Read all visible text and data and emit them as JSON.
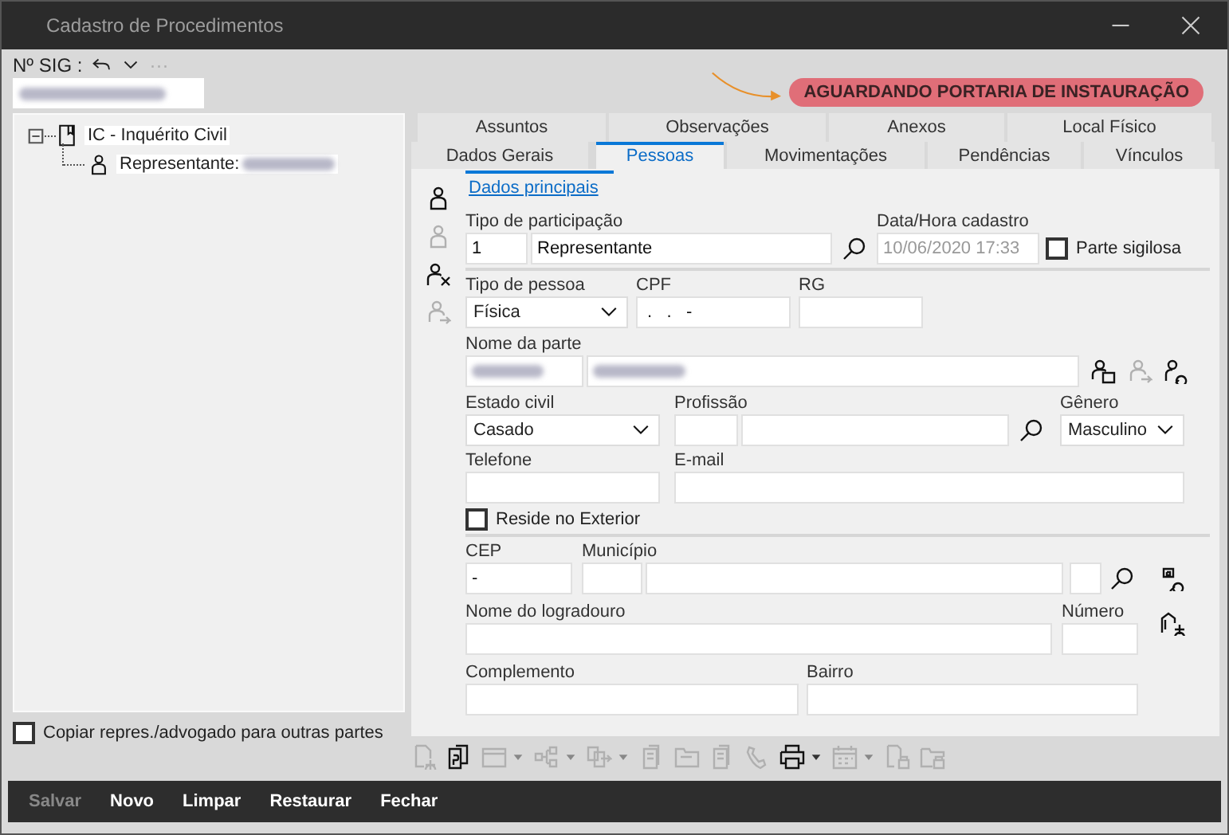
{
  "window": {
    "title": "Cadastro de Procedimentos"
  },
  "sig": {
    "label": "Nº SIG :",
    "more": "···",
    "blurred": true
  },
  "status_badge": {
    "label": "AGUARDANDO PORTARIA DE INSTAURAÇÃO"
  },
  "tree": [
    {
      "label": "IC - Inquérito Civil",
      "expanded": true,
      "children": [
        {
          "label": "Representante:",
          "blurred": true
        }
      ]
    }
  ],
  "copy_option": {
    "label": "Copiar repres./advogado para outras partes",
    "checked": false
  },
  "tabs_back": [
    {
      "label": "Assuntos",
      "selected": false
    },
    {
      "label": "Observações",
      "selected": false
    },
    {
      "label": "Anexos",
      "selected": false
    },
    {
      "label": "Local Físico",
      "selected": false
    }
  ],
  "tabs_front": [
    {
      "label": "Dados Gerais",
      "selected": false
    },
    {
      "label": "Pessoas",
      "selected": true
    },
    {
      "label": "Movimentações",
      "selected": false
    },
    {
      "label": "Pendências",
      "selected": false
    },
    {
      "label": "Vínculos",
      "selected": false
    }
  ],
  "subtabs": [
    {
      "label": "Dados principais",
      "selected": true
    }
  ],
  "side_tools": [
    {
      "kind": "person",
      "disabled": false
    },
    {
      "kind": "person",
      "disabled": true
    },
    {
      "kind": "person-remove",
      "disabled": false
    },
    {
      "kind": "person-swap",
      "disabled": true
    }
  ],
  "form": {
    "participation": {
      "label": "Tipo de participação",
      "code": "1",
      "value": "Representante"
    },
    "registered": {
      "label": "Data/Hora cadastro",
      "value": "10/06/2020 17:33",
      "disabled": true
    },
    "secret": {
      "label": "Parte sigilosa",
      "checked": false
    },
    "person_type": {
      "label": "Tipo de pessoa",
      "value": "Física"
    },
    "cpf": {
      "label": "CPF",
      "value": " .   .   -"
    },
    "rg": {
      "label": "RG"
    },
    "name": {
      "label": "Nome da parte",
      "blurred": true
    },
    "name_tools": [
      {
        "kind": "person-card",
        "disabled": false
      },
      {
        "kind": "person-swap",
        "disabled": true
      },
      {
        "kind": "person-search",
        "disabled": false
      }
    ],
    "marital": {
      "label": "Estado civil",
      "value": "Casado"
    },
    "profession": {
      "label": "Profissão"
    },
    "gender": {
      "label": "Gênero",
      "value": "Masculino"
    },
    "phone": {
      "label": "Telefone"
    },
    "email": {
      "label": "E-mail"
    },
    "abroad": {
      "label": "Reside no Exterior",
      "checked": false
    },
    "cep": {
      "label": "CEP",
      "value": "-"
    },
    "city": {
      "label": "Município"
    },
    "street": {
      "label": "Nome do logradouro"
    },
    "number": {
      "label": "Número"
    },
    "complement": {
      "label": "Complemento"
    },
    "district": {
      "label": "Bairro"
    }
  },
  "toolbar": [
    {
      "kind": "doc-add",
      "disabled": true,
      "menu": false
    },
    {
      "kind": "copy",
      "disabled": false,
      "menu": false
    },
    {
      "kind": "window",
      "disabled": true,
      "menu": true
    },
    {
      "kind": "tree",
      "disabled": true,
      "menu": true
    },
    {
      "kind": "transfer",
      "disabled": true,
      "menu": true
    },
    {
      "kind": "clipboard",
      "disabled": true,
      "menu": false
    },
    {
      "kind": "folder",
      "disabled": true,
      "menu": false
    },
    {
      "kind": "clipboard",
      "disabled": true,
      "menu": false
    },
    {
      "kind": "phone",
      "disabled": true,
      "menu": false
    },
    {
      "kind": "printer",
      "disabled": false,
      "menu": true
    },
    {
      "kind": "calendar",
      "disabled": true,
      "menu": true
    },
    {
      "kind": "doc-lock",
      "disabled": true,
      "menu": false
    },
    {
      "kind": "folder-lock",
      "disabled": true,
      "menu": false
    }
  ],
  "buttons": [
    {
      "label": "Salvar",
      "disabled": true
    },
    {
      "label": "Novo",
      "disabled": false
    },
    {
      "label": "Limpar",
      "disabled": false
    },
    {
      "label": "Restaurar",
      "disabled": false
    },
    {
      "label": "Fechar",
      "disabled": false
    }
  ]
}
